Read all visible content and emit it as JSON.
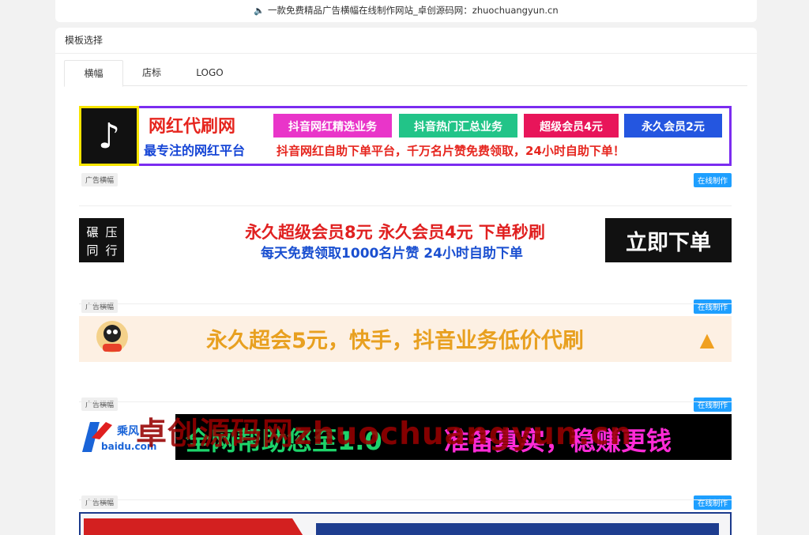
{
  "notice": {
    "text": "一款免费精品广告横幅在线制作网站_卓创源码网：zhuochuangyun.cn"
  },
  "panel": {
    "title": "模板选择"
  },
  "tabs": [
    {
      "label": "横幅"
    },
    {
      "label": "店标"
    },
    {
      "label": "LOGO"
    }
  ],
  "items": [
    {
      "tag": "广告横幅",
      "action": "在线制作",
      "banner": {
        "title": "网红代刷网",
        "subtitle": "最专注的网红平台",
        "b1": "抖音网红精选业务",
        "b2": "抖音热门汇总业务",
        "b3": "超级会员4元",
        "b4": "永久会员2元",
        "line": "抖音网红自助下单平台，千万名片赞免费领取，24小时自助下单！"
      }
    },
    {
      "tag": "广告横幅",
      "action": "在线制作",
      "banner": {
        "logo1": "碾",
        "logo2": "压",
        "logo3": "同",
        "logo4": "行",
        "line1": "永久超级会员8元  永久会员4元  下单秒刷",
        "line2": "每天免费领取1000名片赞  24小时自助下单",
        "cta": "立即下单"
      }
    },
    {
      "tag": "广告横幅",
      "action": "在线制作",
      "banner": {
        "text": "永久超会5元，快手，抖音业务低价代刷"
      }
    },
    {
      "tag": "广告横幅",
      "action": "在线制作",
      "banner": {
        "brand": "乘风",
        "domain": "baidu.com",
        "left": "全网帮助您至1.0",
        "right": "准备真实，稳赚更钱"
      }
    }
  ],
  "watermark": "卓创源码网zhuochuangyun.cn"
}
